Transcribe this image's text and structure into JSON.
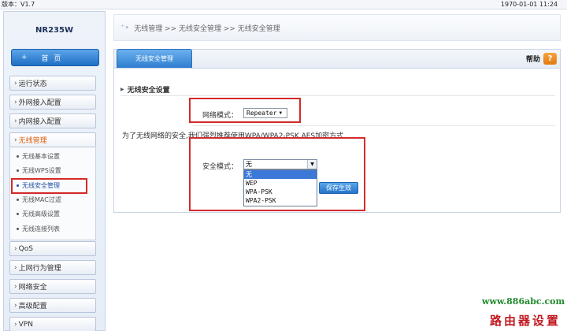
{
  "topbar": {
    "version": "版本：V1.7",
    "datetime": "1970-01-01 11:24"
  },
  "sidebar": {
    "model": "NR235W",
    "home_plus": "+",
    "home_label": "首 页",
    "menu": [
      {
        "label": "运行状态"
      },
      {
        "label": "外网接入配置"
      },
      {
        "label": "内网接入配置"
      },
      {
        "label": "无线管理"
      },
      {
        "label": "QoS"
      },
      {
        "label": "上网行为管理"
      },
      {
        "label": "网络安全"
      },
      {
        "label": "高级配置"
      },
      {
        "label": "VPN"
      }
    ],
    "wireless_sub": [
      {
        "label": "无线基本设置"
      },
      {
        "label": "无线WPS设置"
      },
      {
        "label": "无线安全管理"
      },
      {
        "label": "无线MAC过滤"
      },
      {
        "label": "无线高级设置"
      },
      {
        "label": "无线连接列表"
      }
    ],
    "chevron": "›"
  },
  "breadcrumb": {
    "icon": "⁺•",
    "text": "无线管理  >>  无线安全管理  >>  无线安全管理"
  },
  "panel": {
    "tab_label": "无线安全管理",
    "help_label": "帮助",
    "help_icon": "?",
    "section_title": "无线安全设置",
    "network_mode_label": "网络模式：",
    "network_mode_value": "Repeater",
    "note": "为了无线网络的安全,我们强烈推荐使用WPA/WPA2-PSK AES加密方式.",
    "security_mode_label": "安全模式：",
    "security_mode_value": "无",
    "security_options": [
      "无",
      "WEP",
      "WPA-PSK",
      "WPA2-PSK"
    ],
    "save_label": "保存生效"
  },
  "watermark": {
    "url": "www.886abc.com",
    "cn": "路由器设置"
  },
  "colors": {
    "accent_blue": "#2e7dd0",
    "highlight_red": "#d42a2a",
    "active_orange": "#e06010"
  }
}
